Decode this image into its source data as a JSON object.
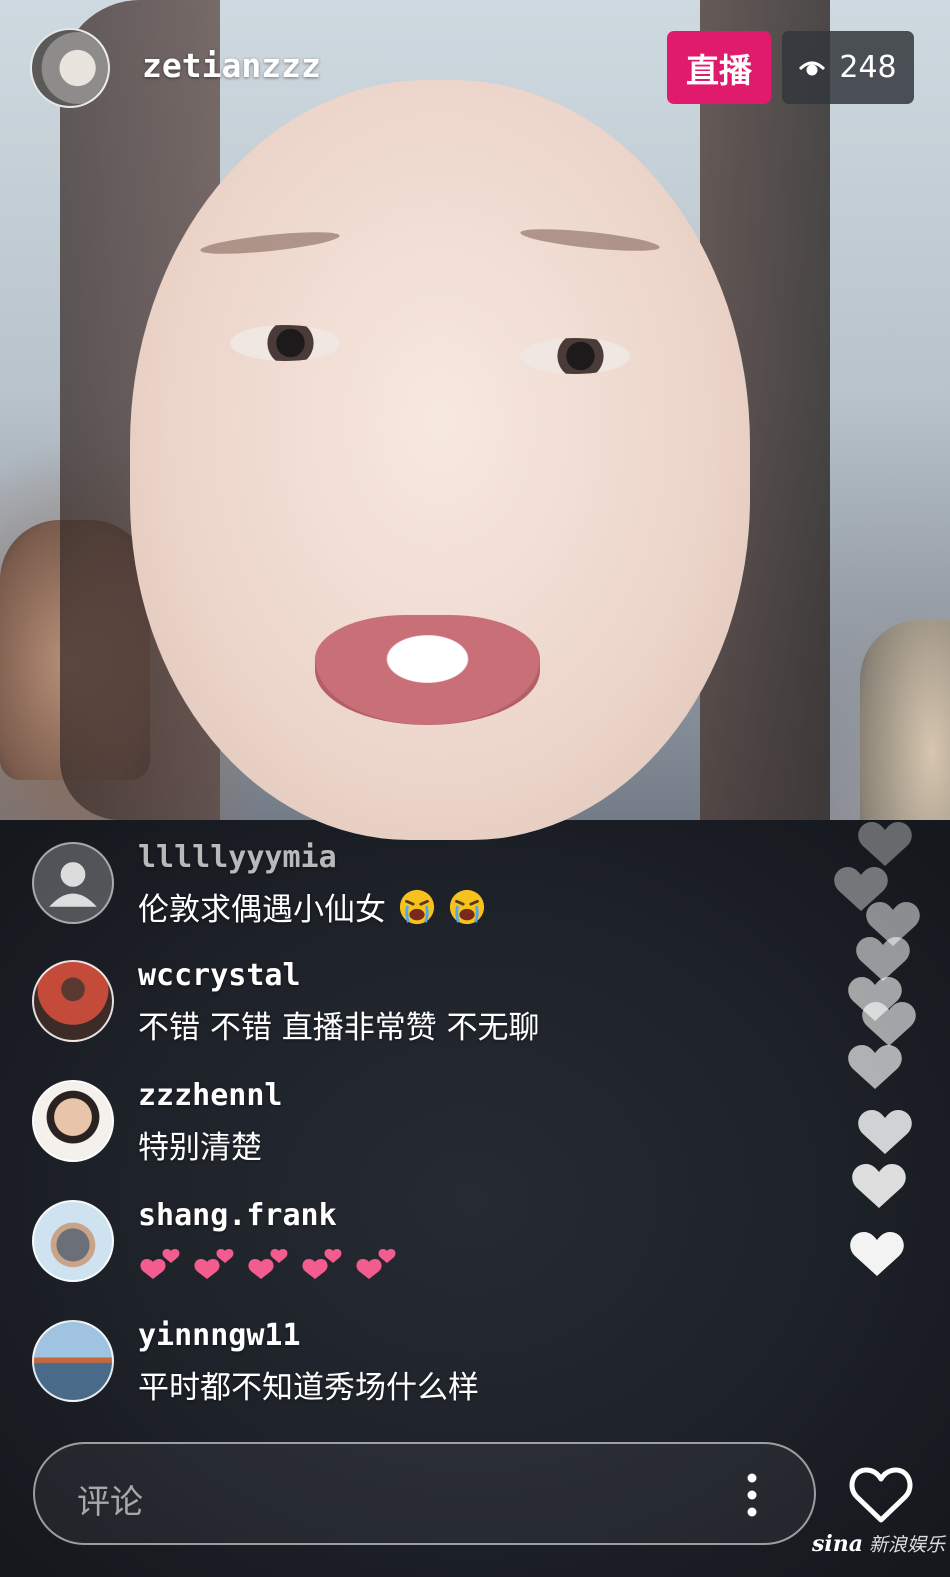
{
  "header": {
    "host_name": "zetianzzz",
    "live_label": "直播",
    "viewer_count": "248"
  },
  "comments": [
    {
      "user": "lllllyyymia",
      "text": "伦敦求偶遇小仙女",
      "emoji": [
        "crying-face",
        "crying-face"
      ],
      "avatar": "default-avatar"
    },
    {
      "user": "wccrystal",
      "text": "不错 不错 直播非常赞 不无聊",
      "avatar": "photo-avatar"
    },
    {
      "user": "zzzhennl",
      "text": "特别清楚",
      "avatar": "photo-avatar"
    },
    {
      "user": "shang.frank",
      "text": "",
      "pink_hearts": 5,
      "avatar": "photo-avatar"
    },
    {
      "user": "yinnngw11",
      "text": "平时都不知道秀场什么样",
      "avatar": "photo-avatar"
    }
  ],
  "input": {
    "placeholder": "评论"
  },
  "watermark": {
    "brand": "sina",
    "text": "新浪娱乐"
  },
  "colors": {
    "live_badge": "#e01a6c",
    "viewer_badge": "#32373c",
    "pink_heart": "#f25c8f"
  },
  "icons": [
    "eye-icon",
    "more-vertical-icon",
    "heart-outline-icon",
    "heart-icon",
    "crying-face-emoji"
  ]
}
